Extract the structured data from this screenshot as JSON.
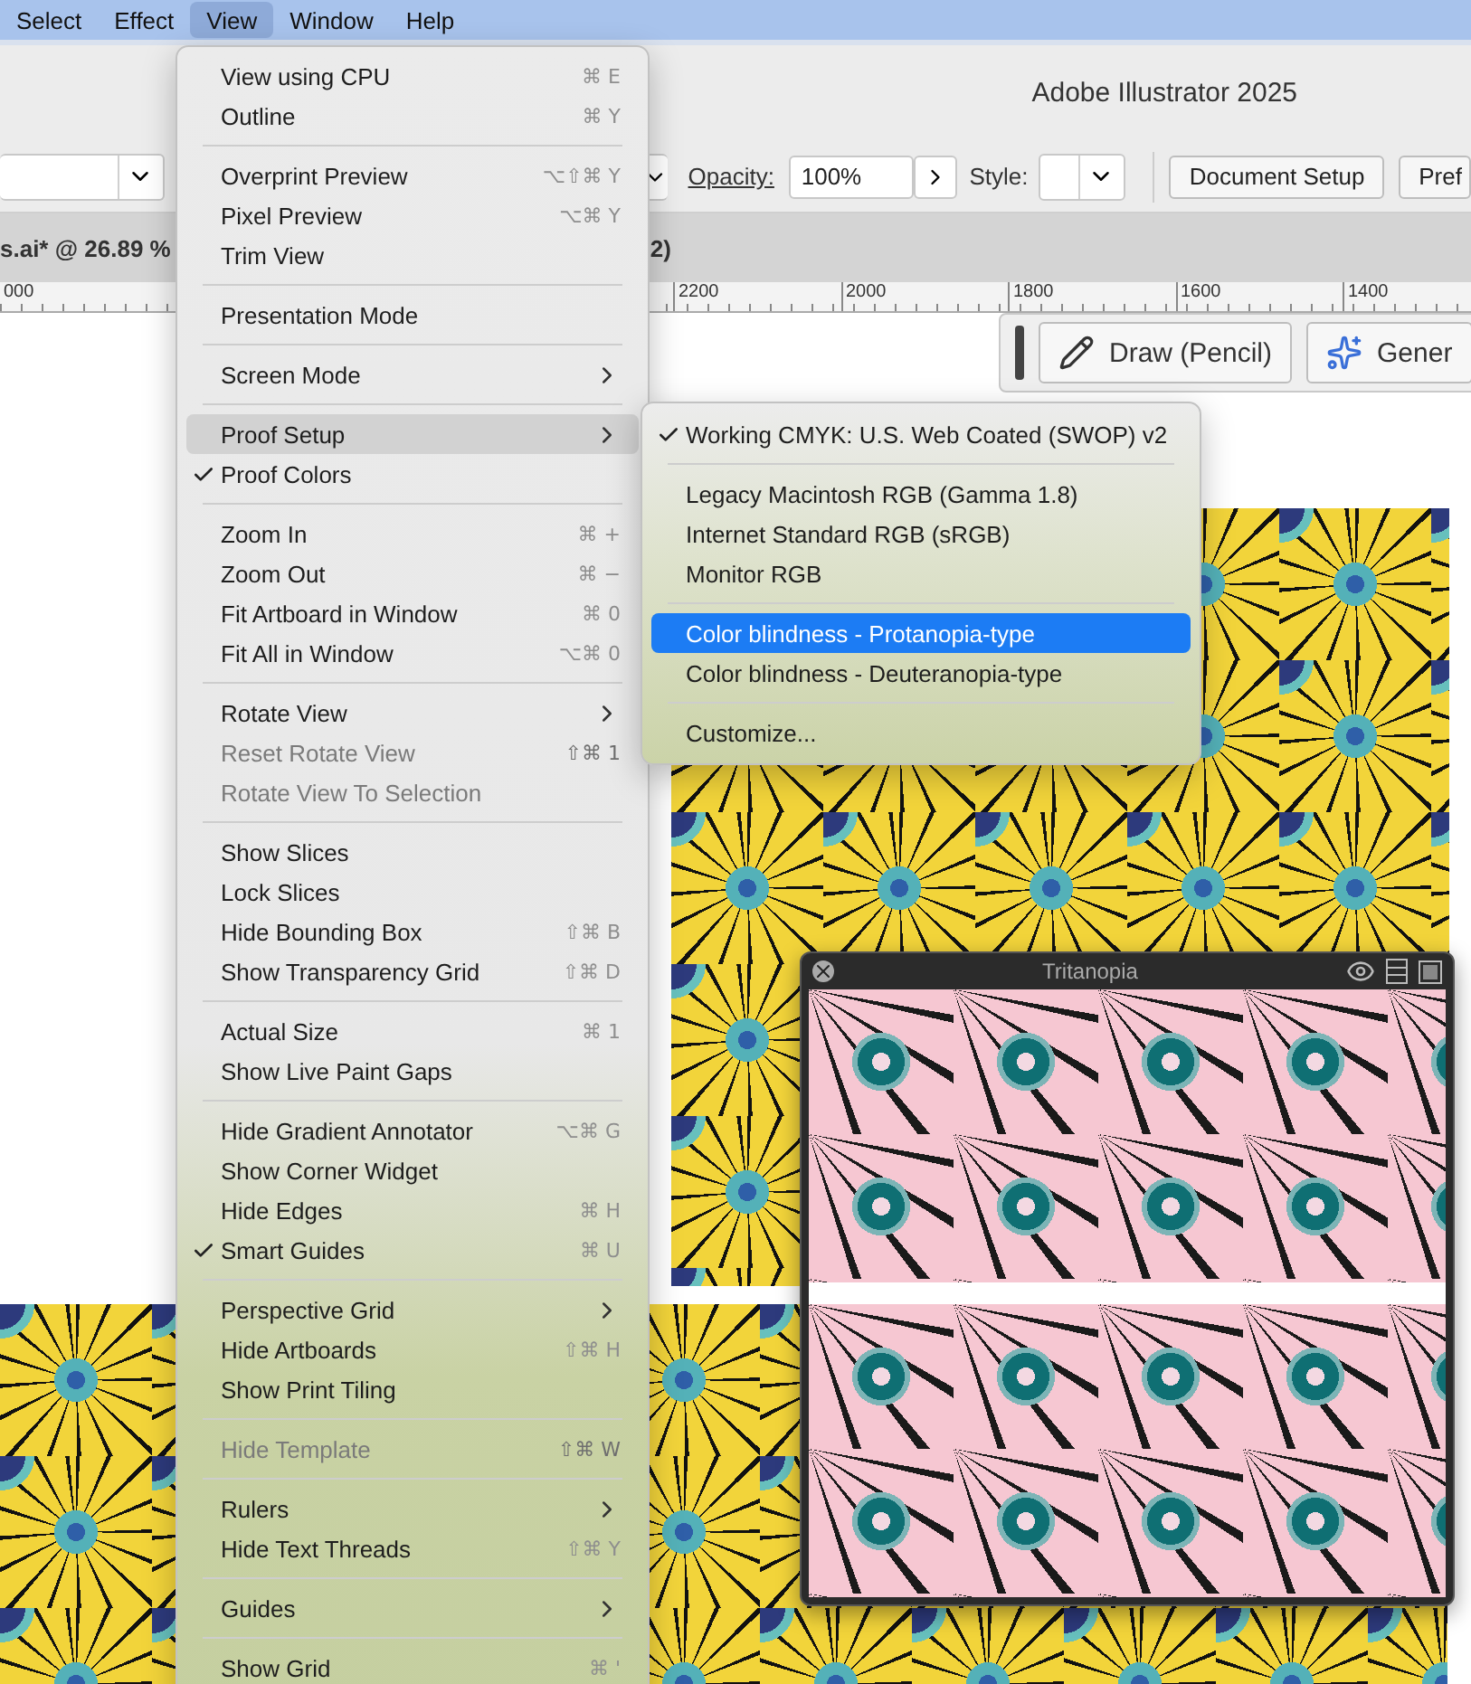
{
  "menu_bar": [
    {
      "label": "Select",
      "selected": false
    },
    {
      "label": "Effect",
      "selected": false
    },
    {
      "label": "View",
      "selected": true
    },
    {
      "label": "Window",
      "selected": false
    },
    {
      "label": "Help",
      "selected": false
    }
  ],
  "window": {
    "title": "Adobe Illustrator 2025"
  },
  "control_bar": {
    "opacity_label": "Opacity:",
    "opacity_value": "100%",
    "style_label": "Style:",
    "buttons": [
      "Document Setup",
      "Pref"
    ]
  },
  "document_tabs": [
    "s.ai* @ 26.89 %",
    "2)"
  ],
  "ruler": [
    "000",
    "2200",
    "2000",
    "1800",
    "1600",
    "1400"
  ],
  "floating_toolbar": {
    "buttons": [
      {
        "label": "Draw (Pencil)",
        "kind": "pencil"
      },
      {
        "label": "Gener",
        "kind": "sparkle"
      }
    ]
  },
  "view_menu": [
    {
      "kind": "item",
      "label": "View using CPU",
      "shortcut": "⌘ E",
      "checked": false,
      "disabled": false,
      "submenu": false,
      "selected": false
    },
    {
      "kind": "item",
      "label": "Outline",
      "shortcut": "⌘ Y",
      "checked": false,
      "disabled": false,
      "submenu": false,
      "selected": false
    },
    {
      "kind": "separator"
    },
    {
      "kind": "item",
      "label": "Overprint Preview",
      "shortcut": "⌥⇧⌘ Y",
      "checked": false,
      "disabled": false,
      "submenu": false,
      "selected": false
    },
    {
      "kind": "item",
      "label": "Pixel Preview",
      "shortcut": "⌥⌘ Y",
      "checked": false,
      "disabled": false,
      "submenu": false,
      "selected": false
    },
    {
      "kind": "item",
      "label": "Trim View",
      "checked": false,
      "disabled": false,
      "submenu": false,
      "selected": false
    },
    {
      "kind": "separator"
    },
    {
      "kind": "item",
      "label": "Presentation Mode",
      "checked": false,
      "disabled": false,
      "submenu": false,
      "selected": false
    },
    {
      "kind": "separator"
    },
    {
      "kind": "item",
      "label": "Screen Mode",
      "checked": false,
      "disabled": false,
      "submenu": true,
      "selected": false
    },
    {
      "kind": "separator"
    },
    {
      "kind": "item",
      "label": "Proof Setup",
      "checked": false,
      "disabled": false,
      "submenu": true,
      "selected": true
    },
    {
      "kind": "item",
      "label": "Proof Colors",
      "checked": true,
      "disabled": false,
      "submenu": false,
      "selected": false
    },
    {
      "kind": "separator"
    },
    {
      "kind": "item",
      "label": "Zoom In",
      "shortcut": "⌘ +",
      "checked": false,
      "disabled": false,
      "submenu": false,
      "selected": false
    },
    {
      "kind": "item",
      "label": "Zoom Out",
      "shortcut": "⌘ −",
      "checked": false,
      "disabled": false,
      "submenu": false,
      "selected": false
    },
    {
      "kind": "item",
      "label": "Fit Artboard in Window",
      "shortcut": "⌘ 0",
      "checked": false,
      "disabled": false,
      "submenu": false,
      "selected": false
    },
    {
      "kind": "item",
      "label": "Fit All in Window",
      "shortcut": "⌥⌘ 0",
      "checked": false,
      "disabled": false,
      "submenu": false,
      "selected": false
    },
    {
      "kind": "separator"
    },
    {
      "kind": "item",
      "label": "Rotate View",
      "checked": false,
      "disabled": false,
      "submenu": true,
      "selected": false
    },
    {
      "kind": "item",
      "label": "Reset Rotate View",
      "shortcut": "⇧⌘ 1",
      "checked": false,
      "disabled": true,
      "submenu": false,
      "selected": false
    },
    {
      "kind": "item",
      "label": "Rotate View To Selection",
      "checked": false,
      "disabled": true,
      "submenu": false,
      "selected": false
    },
    {
      "kind": "separator"
    },
    {
      "kind": "item",
      "label": "Show Slices",
      "checked": false,
      "disabled": false,
      "submenu": false,
      "selected": false
    },
    {
      "kind": "item",
      "label": "Lock Slices",
      "checked": false,
      "disabled": false,
      "submenu": false,
      "selected": false
    },
    {
      "kind": "item",
      "label": "Hide Bounding Box",
      "shortcut": "⇧⌘ B",
      "checked": false,
      "disabled": false,
      "submenu": false,
      "selected": false
    },
    {
      "kind": "item",
      "label": "Show Transparency Grid",
      "shortcut": "⇧⌘ D",
      "checked": false,
      "disabled": false,
      "submenu": false,
      "selected": false
    },
    {
      "kind": "separator"
    },
    {
      "kind": "item",
      "label": "Actual Size",
      "shortcut": "⌘ 1",
      "checked": false,
      "disabled": false,
      "submenu": false,
      "selected": false
    },
    {
      "kind": "item",
      "label": "Show Live Paint Gaps",
      "checked": false,
      "disabled": false,
      "submenu": false,
      "selected": false
    },
    {
      "kind": "separator"
    },
    {
      "kind": "item",
      "label": "Hide Gradient Annotator",
      "shortcut": "⌥⌘ G",
      "checked": false,
      "disabled": false,
      "submenu": false,
      "selected": false
    },
    {
      "kind": "item",
      "label": "Show Corner Widget",
      "checked": false,
      "disabled": false,
      "submenu": false,
      "selected": false
    },
    {
      "kind": "item",
      "label": "Hide Edges",
      "shortcut": "⌘ H",
      "checked": false,
      "disabled": false,
      "submenu": false,
      "selected": false
    },
    {
      "kind": "item",
      "label": "Smart Guides",
      "shortcut": "⌘ U",
      "checked": true,
      "disabled": false,
      "submenu": false,
      "selected": false
    },
    {
      "kind": "separator"
    },
    {
      "kind": "item",
      "label": "Perspective Grid",
      "checked": false,
      "disabled": false,
      "submenu": true,
      "selected": false
    },
    {
      "kind": "item",
      "label": "Hide Artboards",
      "shortcut": "⇧⌘ H",
      "checked": false,
      "disabled": false,
      "submenu": false,
      "selected": false
    },
    {
      "kind": "item",
      "label": "Show Print Tiling",
      "checked": false,
      "disabled": false,
      "submenu": false,
      "selected": false
    },
    {
      "kind": "separator"
    },
    {
      "kind": "item",
      "label": "Hide Template",
      "shortcut": "⇧⌘ W",
      "checked": false,
      "disabled": true,
      "submenu": false,
      "selected": false
    },
    {
      "kind": "separator"
    },
    {
      "kind": "item",
      "label": "Rulers",
      "checked": false,
      "disabled": false,
      "submenu": true,
      "selected": false
    },
    {
      "kind": "item",
      "label": "Hide Text Threads",
      "shortcut": "⇧⌘ Y",
      "checked": false,
      "disabled": false,
      "submenu": false,
      "selected": false
    },
    {
      "kind": "separator"
    },
    {
      "kind": "item",
      "label": "Guides",
      "checked": false,
      "disabled": false,
      "submenu": true,
      "selected": false
    },
    {
      "kind": "separator"
    },
    {
      "kind": "item",
      "label": "Show Grid",
      "shortcut": "⌘ '",
      "checked": false,
      "disabled": false,
      "submenu": false,
      "selected": false
    }
  ],
  "proof_setup_menu": [
    {
      "kind": "item",
      "label": "Working CMYK: U.S. Web Coated (SWOP) v2",
      "checked": true,
      "selected": false
    },
    {
      "kind": "separator"
    },
    {
      "kind": "item",
      "label": "Legacy Macintosh RGB (Gamma 1.8)",
      "checked": false,
      "selected": false
    },
    {
      "kind": "item",
      "label": "Internet Standard RGB (sRGB)",
      "checked": false,
      "selected": false
    },
    {
      "kind": "item",
      "label": "Monitor RGB",
      "checked": false,
      "selected": false
    },
    {
      "kind": "separator"
    },
    {
      "kind": "item",
      "label": "Color blindness - Protanopia-type",
      "checked": false,
      "selected": true
    },
    {
      "kind": "item",
      "label": "Color blindness - Deuteranopia-type",
      "checked": false,
      "selected": false
    },
    {
      "kind": "separator"
    },
    {
      "kind": "item",
      "label": "Customize...",
      "checked": false,
      "selected": false
    }
  ],
  "preview_panel": {
    "title": "Tritanopia"
  }
}
